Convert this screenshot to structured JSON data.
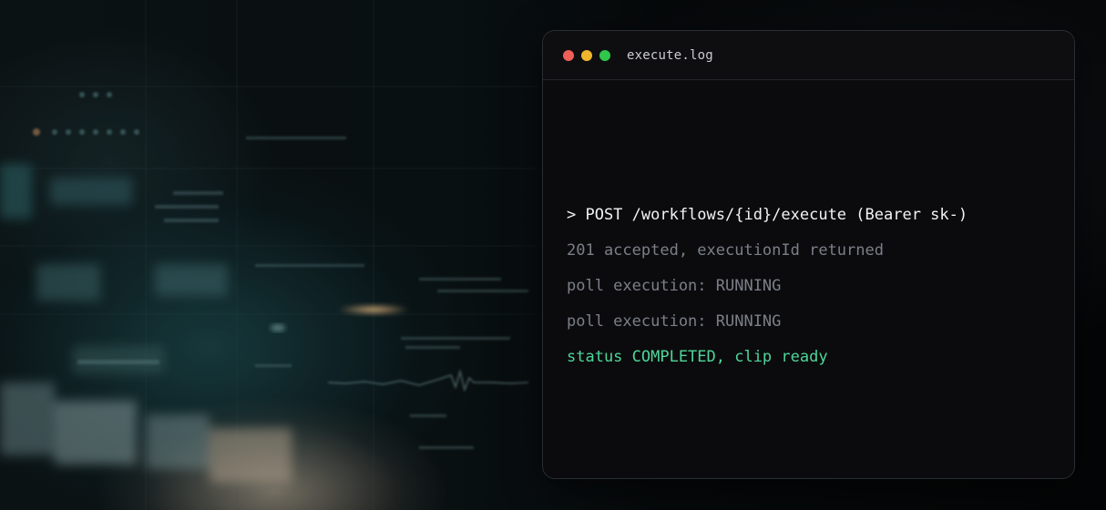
{
  "terminal": {
    "title": "execute.log",
    "lines": [
      {
        "text": "> POST /workflows/{id}/execute (Bearer sk-)",
        "kind": "command",
        "color": "#f2f3f5"
      },
      {
        "text": "201 accepted, executionId returned",
        "kind": "output",
        "color": "#7b7f88"
      },
      {
        "text": "poll execution: RUNNING",
        "kind": "output",
        "color": "#7b7f88"
      },
      {
        "text": "poll execution: RUNNING",
        "kind": "output",
        "color": "#7b7f88"
      },
      {
        "text": "status COMPLETED, clip ready",
        "kind": "success",
        "color": "#4fd69a"
      }
    ],
    "window_controls": [
      {
        "icon": "close-dot-icon",
        "color": "#ee5f57"
      },
      {
        "icon": "minimize-dot-icon",
        "color": "#f0b62d"
      },
      {
        "icon": "maximize-dot-icon",
        "color": "#2fc84a"
      }
    ]
  },
  "theme": {
    "background": "#06080a",
    "accent_teal": "#2a7f84",
    "success_green": "#4fd69a"
  }
}
